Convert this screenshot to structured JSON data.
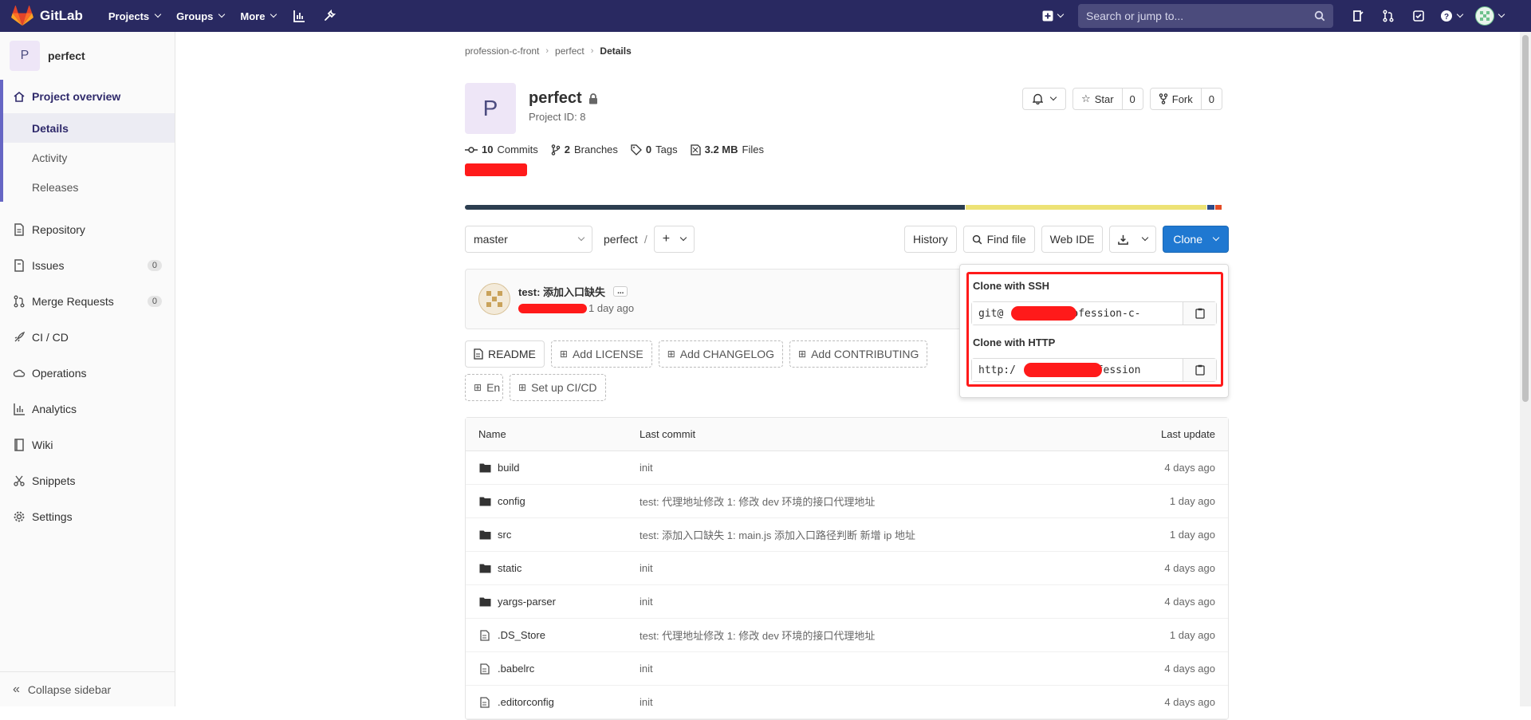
{
  "navbar": {
    "brand": "GitLab",
    "menu": [
      "Projects",
      "Groups",
      "More"
    ],
    "search_placeholder": "Search or jump to..."
  },
  "sidebar": {
    "project_initial": "P",
    "project_name": "perfect",
    "overview_label": "Project overview",
    "overview_sub": [
      "Details",
      "Activity",
      "Releases"
    ],
    "items": [
      {
        "label": "Repository",
        "icon": "document-icon"
      },
      {
        "label": "Issues",
        "icon": "issues-icon",
        "badge": "0"
      },
      {
        "label": "Merge Requests",
        "icon": "merge-request-icon",
        "badge": "0"
      },
      {
        "label": "CI / CD",
        "icon": "rocket-icon"
      },
      {
        "label": "Operations",
        "icon": "cloud-icon"
      },
      {
        "label": "Analytics",
        "icon": "chart-icon"
      },
      {
        "label": "Wiki",
        "icon": "book-icon"
      },
      {
        "label": "Snippets",
        "icon": "scissors-icon"
      },
      {
        "label": "Settings",
        "icon": "gear-icon"
      }
    ],
    "collapse_label": "Collapse sidebar"
  },
  "breadcrumb": [
    "profession-c-front",
    "perfect",
    "Details"
  ],
  "project": {
    "initial": "P",
    "name": "perfect",
    "id_label": "Project ID: 8",
    "star_label": "Star",
    "star_count": "0",
    "fork_label": "Fork",
    "fork_count": "0"
  },
  "stats": {
    "commits_num": "10",
    "commits_label": "Commits",
    "branches_num": "2",
    "branches_label": "Branches",
    "tags_num": "0",
    "tags_label": "Tags",
    "files_num": "3.2 MB",
    "files_label": "Files"
  },
  "language_bar": [
    {
      "share": 0.655,
      "color": "#2c3e50"
    },
    {
      "share": 0.315,
      "color": "#ede275"
    },
    {
      "share": 0.009,
      "color": "#2b4b8a"
    },
    {
      "share": 0.008,
      "color": "#e34c26"
    }
  ],
  "tree": {
    "branch": "master",
    "path_root": "perfect",
    "path_sep": "/",
    "history_label": "History",
    "find_file_label": "Find file",
    "web_ide_label": "Web IDE",
    "clone_label": "Clone"
  },
  "commit": {
    "title": "test: 添加入口缺失",
    "ellipsis": "...",
    "time": "1 day ago"
  },
  "quick_buttons": [
    "README",
    "Add LICENSE",
    "Add CHANGELOG",
    "Add CONTRIBUTING",
    "En",
    "Set up CI/CD"
  ],
  "clone_dropdown": {
    "ssh_label": "Clone with SSH",
    "ssh_value": "git@        :profession-c-",
    "http_label": "Clone with HTTP",
    "http_value": "http:/          profession"
  },
  "file_table": {
    "headers": [
      "Name",
      "Last commit",
      "Last update"
    ],
    "rows": [
      {
        "name": "build",
        "type": "folder",
        "commit": "init",
        "date": "4 days ago"
      },
      {
        "name": "config",
        "type": "folder",
        "commit": "test: 代理地址修改 1: 修改 dev 环境的接口代理地址",
        "date": "1 day ago"
      },
      {
        "name": "src",
        "type": "folder",
        "commit": "test: 添加入口缺失 1: main.js 添加入口路径判断 新增 ip 地址",
        "date": "1 day ago"
      },
      {
        "name": "static",
        "type": "folder",
        "commit": "init",
        "date": "4 days ago"
      },
      {
        "name": "yargs-parser",
        "type": "folder",
        "commit": "init",
        "date": "4 days ago"
      },
      {
        "name": ".DS_Store",
        "type": "file",
        "commit": "test: 代理地址修改 1: 修改 dev 环境的接口代理地址",
        "date": "1 day ago"
      },
      {
        "name": ".babelrc",
        "type": "file",
        "commit": "init",
        "date": "4 days ago"
      },
      {
        "name": ".editorconfig",
        "type": "file",
        "commit": "init",
        "date": "4 days ago"
      }
    ]
  }
}
